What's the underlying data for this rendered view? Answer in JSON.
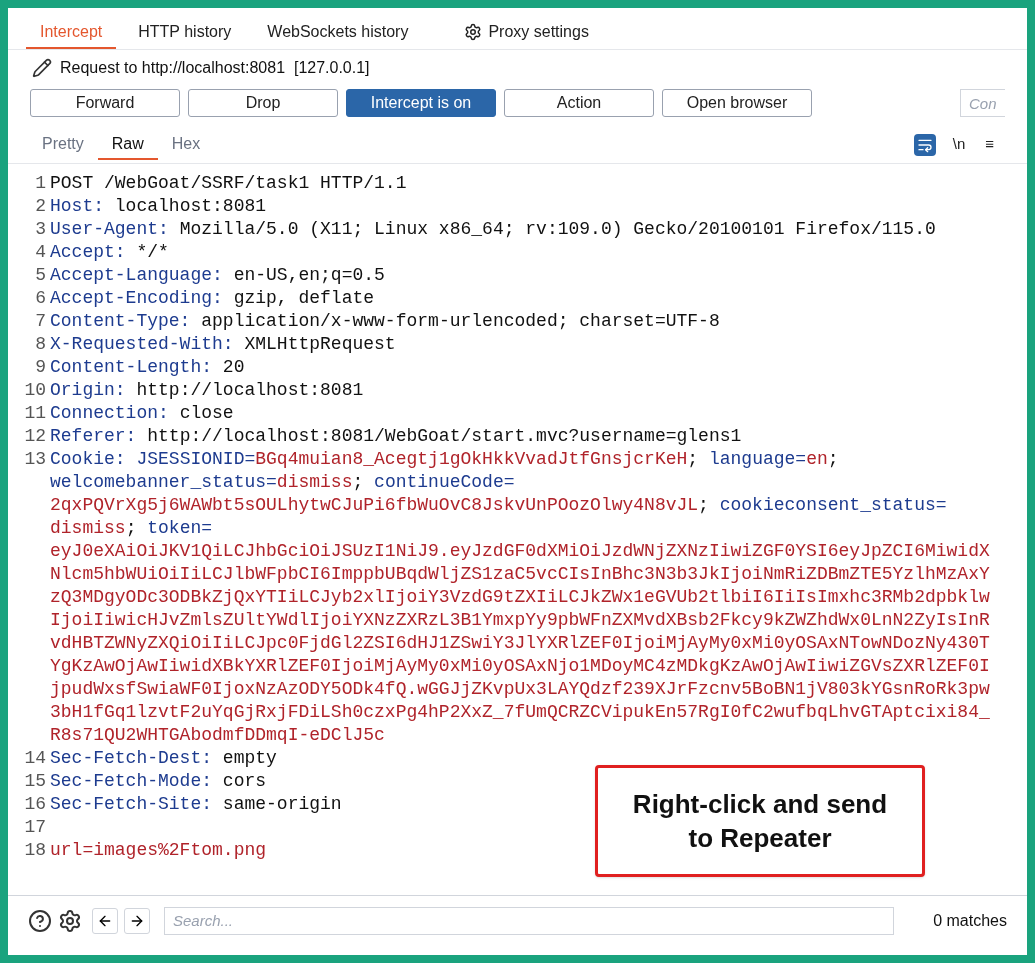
{
  "tabs": [
    {
      "label": "Intercept",
      "selected": true
    },
    {
      "label": "HTTP history",
      "selected": false
    },
    {
      "label": "WebSockets history",
      "selected": false
    },
    {
      "label": "Proxy settings",
      "selected": false,
      "kind": "settings"
    }
  ],
  "request_line": "Request to http://localhost:8081  [127.0.0.1]",
  "buttons": [
    {
      "label": "Forward",
      "on": false
    },
    {
      "label": "Drop",
      "on": false
    },
    {
      "label": "Intercept is on",
      "on": true
    },
    {
      "label": "Action",
      "on": false
    },
    {
      "label": "Open browser",
      "on": false
    }
  ],
  "comment_field": {
    "placeholder": "Con"
  },
  "view_tabs": [
    {
      "label": "Pretty",
      "selected": false
    },
    {
      "label": "Raw",
      "selected": true
    },
    {
      "label": "Hex",
      "selected": false
    }
  ],
  "view_toggles": [
    {
      "kind": "wrap",
      "selected": true
    },
    {
      "kind": "newline",
      "label": "\\n",
      "selected": false
    },
    {
      "kind": "menu",
      "label": "≡",
      "selected": false
    }
  ],
  "lines": [
    {
      "number": "1",
      "rows": [
        {
          "parts": [
            {
              "kind": "text",
              "text": "POST /WebGoat/SSRF/task1 HTTP/1.1"
            }
          ]
        }
      ]
    },
    {
      "number": "2",
      "rows": [
        {
          "parts": [
            {
              "kind": "key",
              "text": "Host:"
            },
            {
              "kind": "text",
              "text": " localhost:8081"
            }
          ]
        }
      ]
    },
    {
      "number": "3",
      "rows": [
        {
          "parts": [
            {
              "kind": "key",
              "text": "User-Agent:"
            },
            {
              "kind": "text",
              "text": " Mozilla/5.0 (X11; Linux x86_64; rv:109.0) Gecko/20100101 Firefox/115.0"
            }
          ]
        }
      ]
    },
    {
      "number": "4",
      "rows": [
        {
          "parts": [
            {
              "kind": "key",
              "text": "Accept:"
            },
            {
              "kind": "text",
              "text": " */*"
            }
          ]
        }
      ]
    },
    {
      "number": "5",
      "rows": [
        {
          "parts": [
            {
              "kind": "key",
              "text": "Accept-Language:"
            },
            {
              "kind": "text",
              "text": " en-US,en;q=0.5"
            }
          ]
        }
      ]
    },
    {
      "number": "6",
      "rows": [
        {
          "parts": [
            {
              "kind": "key",
              "text": "Accept-Encoding:"
            },
            {
              "kind": "text",
              "text": " gzip, deflate"
            }
          ]
        }
      ]
    },
    {
      "number": "7",
      "rows": [
        {
          "parts": [
            {
              "kind": "key",
              "text": "Content-Type:"
            },
            {
              "kind": "text",
              "text": " application/x-www-form-urlencoded; charset=UTF-8"
            }
          ]
        }
      ]
    },
    {
      "number": "8",
      "rows": [
        {
          "parts": [
            {
              "kind": "key",
              "text": "X-Requested-With:"
            },
            {
              "kind": "text",
              "text": " XMLHttpRequest"
            }
          ]
        }
      ]
    },
    {
      "number": "9",
      "rows": [
        {
          "parts": [
            {
              "kind": "key",
              "text": "Content-Length:"
            },
            {
              "kind": "text",
              "text": " 20"
            }
          ]
        }
      ]
    },
    {
      "number": "10",
      "rows": [
        {
          "parts": [
            {
              "kind": "key",
              "text": "Origin:"
            },
            {
              "kind": "text",
              "text": " http://localhost:8081"
            }
          ]
        }
      ]
    },
    {
      "number": "11",
      "rows": [
        {
          "parts": [
            {
              "kind": "key",
              "text": "Connection:"
            },
            {
              "kind": "text",
              "text": " close"
            }
          ]
        }
      ]
    },
    {
      "number": "12",
      "rows": [
        {
          "parts": [
            {
              "kind": "key",
              "text": "Referer:"
            },
            {
              "kind": "text",
              "text": " http://localhost:8081/WebGoat/start.mvc?username=glens1"
            }
          ]
        }
      ]
    },
    {
      "number": "13",
      "rows": [
        {
          "parts": [
            {
              "kind": "key",
              "text": "Cookie:"
            },
            {
              "kind": "key",
              "text": " JSESSIONID="
            },
            {
              "kind": "value",
              "text": "BGq4muian8_Acegtj1gOkHkkVvadJtfGnsjcrKeH"
            },
            {
              "kind": "text",
              "text": "; "
            },
            {
              "kind": "key",
              "text": "language="
            },
            {
              "kind": "value",
              "text": "en"
            },
            {
              "kind": "text",
              "text": ";"
            }
          ]
        },
        {
          "parts": [
            {
              "kind": "key",
              "text": "welcomebanner_status="
            },
            {
              "kind": "value",
              "text": "dismiss"
            },
            {
              "kind": "text",
              "text": "; "
            },
            {
              "kind": "key",
              "text": "continueCode="
            }
          ]
        },
        {
          "parts": [
            {
              "kind": "value",
              "text": "2qxPQVrXg5j6WAWbt5sOULhytwCJuPi6fbWuOvC8JskvUnPOozOlwy4N8vJL"
            },
            {
              "kind": "text",
              "text": "; "
            },
            {
              "kind": "key",
              "text": "cookieconsent_status="
            }
          ]
        },
        {
          "parts": [
            {
              "kind": "value",
              "text": "dismiss"
            },
            {
              "kind": "text",
              "text": "; "
            },
            {
              "kind": "key",
              "text": "token="
            }
          ]
        },
        {
          "parts": [
            {
              "kind": "value",
              "text": "eyJ0eXAiOiJKV1QiLCJhbGciOiJSUzI1NiJ9.eyJzdGF0dXMiOiJzdWNjZXNzIiwiZGF0YSI6eyJpZCI6MiwidX"
            }
          ]
        },
        {
          "parts": [
            {
              "kind": "value",
              "text": "Nlcm5hbWUiOiIiLCJlbWFpbCI6ImppbUBqdWljZS1zaC5vcCIsInBhc3N3b3JkIjoiNmRiZDBmZTE5YzlhMzAxY"
            }
          ]
        },
        {
          "parts": [
            {
              "kind": "value",
              "text": "zQ3MDgyODc3ODBkZjQxYTIiLCJyb2xlIjoiY3VzdG9tZXIiLCJkZWx1eGVUb2tlbiI6IiIsImxhc3RMb2dpbklw"
            }
          ]
        },
        {
          "parts": [
            {
              "kind": "value",
              "text": "IjoiIiwicHJvZmlsZUltYWdlIjoiYXNzZXRzL3B1YmxpYy9pbWFnZXMvdXBsb2Fkcy9kZWZhdWx0LnN2ZyIsInR"
            }
          ]
        },
        {
          "parts": [
            {
              "kind": "value",
              "text": "vdHBTZWNyZXQiOiIiLCJpc0FjdGl2ZSI6dHJ1ZSwiY3JlYXRlZEF0IjoiMjAyMy0xMi0yOSAxNTowNDozNy430T"
            }
          ]
        },
        {
          "parts": [
            {
              "kind": "value",
              "text": "YgKzAwOjAwIiwidXBkYXRlZEF0IjoiMjAyMy0xMi0yOSAxNjo1MDoyMC4zMDkgKzAwOjAwIiwiZGVsZXRlZEF0I"
            }
          ]
        },
        {
          "parts": [
            {
              "kind": "value",
              "text": "jpudWxsfSwiaWF0IjoxNzAzODY5ODk4fQ.wGGJjZKvpUx3LAYQdzf239XJrFzcnv5BoBN1jV803kYGsnRoRk3pw"
            }
          ]
        },
        {
          "parts": [
            {
              "kind": "value",
              "text": "3bH1fGq1lzvtF2uYqGjRxjFDiLSh0czxPg4hP2XxZ_7fUmQCRZCVipukEn57RgI0fC2wufbqLhvGTAptcixi84_"
            }
          ]
        },
        {
          "parts": [
            {
              "kind": "value",
              "text": "R8s71QU2WHTGAbodmfDDmqI-eDClJ5c"
            }
          ]
        }
      ]
    },
    {
      "number": "14",
      "rows": [
        {
          "parts": [
            {
              "kind": "key",
              "text": "Sec-Fetch-Dest:"
            },
            {
              "kind": "text",
              "text": " empty"
            }
          ]
        }
      ]
    },
    {
      "number": "15",
      "rows": [
        {
          "parts": [
            {
              "kind": "key",
              "text": "Sec-Fetch-Mode:"
            },
            {
              "kind": "text",
              "text": " cors"
            }
          ]
        }
      ]
    },
    {
      "number": "16",
      "rows": [
        {
          "parts": [
            {
              "kind": "key",
              "text": "Sec-Fetch-Site:"
            },
            {
              "kind": "text",
              "text": " same-origin"
            }
          ]
        }
      ]
    },
    {
      "number": "17",
      "rows": [
        {
          "parts": []
        }
      ]
    },
    {
      "number": "18",
      "rows": [
        {
          "parts": [
            {
              "kind": "value",
              "text": "url=images%2Ftom.png"
            }
          ]
        }
      ]
    }
  ],
  "callout": {
    "text": "Right-click and send to Repeater"
  },
  "search": {
    "placeholder": "Search..."
  },
  "matches": "0 matches"
}
